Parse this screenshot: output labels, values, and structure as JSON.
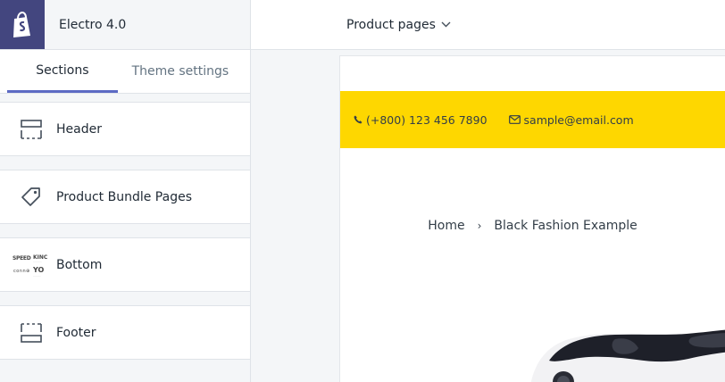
{
  "topbar": {
    "shop_name": "Electro 4.0",
    "page_selector": "Product pages"
  },
  "sidebar": {
    "tabs": [
      {
        "label": "Sections",
        "active": true
      },
      {
        "label": "Theme settings",
        "active": false
      }
    ],
    "sections": [
      {
        "label": "Header",
        "icon": "header-layout-icon"
      },
      {
        "label": "Product Bundle Pages",
        "icon": "tag-icon"
      },
      {
        "label": "Bottom",
        "icon": "logo-list-thumbnail"
      },
      {
        "label": "Footer",
        "icon": "footer-layout-icon"
      }
    ]
  },
  "preview": {
    "phone": "(+800) 123 456 7890",
    "email": "sample@email.com",
    "breadcrumb": {
      "home": "Home",
      "current": "Black Fashion Example"
    },
    "accent_color": "#fed700"
  }
}
